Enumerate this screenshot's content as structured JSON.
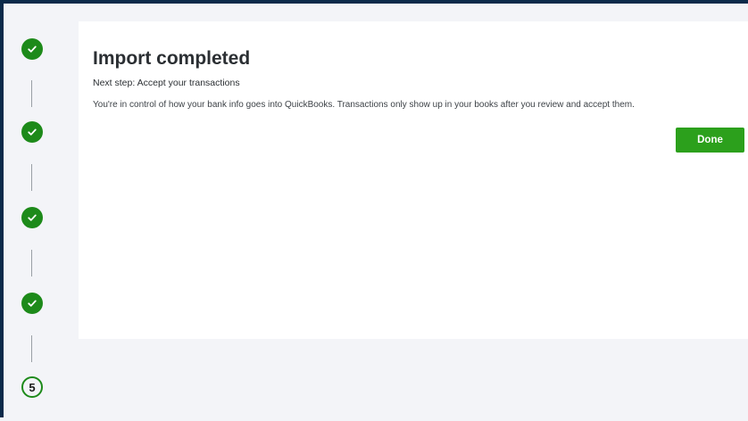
{
  "stepper": {
    "steps": [
      {
        "status": "complete",
        "icon": "check-icon"
      },
      {
        "status": "complete",
        "icon": "check-icon"
      },
      {
        "status": "complete",
        "icon": "check-icon"
      },
      {
        "status": "complete",
        "icon": "check-icon"
      },
      {
        "status": "current",
        "number": "5"
      }
    ]
  },
  "main": {
    "title": "Import completed",
    "subtitle": "Next step: Accept your transactions",
    "description": "You're in control of how your bank info goes into QuickBooks. Transactions only show up in your books after you review and accept them.",
    "done_label": "Done"
  },
  "colors": {
    "accent_green": "#2ca01c",
    "step_green": "#1d8a1a",
    "frame_border": "#0b2a4a",
    "background": "#f3f4f8"
  }
}
